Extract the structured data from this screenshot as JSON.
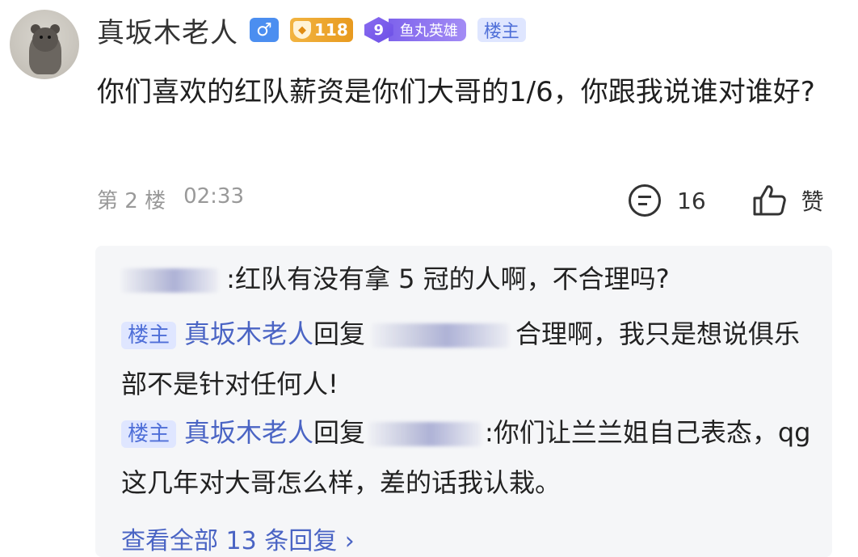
{
  "post": {
    "username": "真坂木老人",
    "gender_icon": "♂",
    "level": "118",
    "fan_level": "9",
    "fan_badge_name": "鱼丸英雄",
    "op_label": "楼主",
    "content": "你们喜欢的红队薪资是你们大哥的1/6，你跟我说谁对谁好?",
    "floor": "第 2 楼",
    "time": "02:33",
    "comment_count": "16",
    "like_label": "赞"
  },
  "replies": [
    {
      "text": ":红队有没有拿 5 冠的人啊，不合理吗?"
    },
    {
      "op_tag": "楼主",
      "user": "真坂木老人",
      "verb": "回复",
      "text": "合理啊，我只是想说俱乐部不是针对任何人!"
    },
    {
      "op_tag": "楼主",
      "user": "真坂木老人",
      "verb": "回复",
      "text": ":你们让兰兰姐自己表态，qg这几年对大哥怎么样，差的话我认栽。"
    }
  ],
  "view_all": "查看全部 13 条回复 ›",
  "colors": {
    "link": "#4a64c4",
    "op_badge_bg": "#dfe6ff",
    "reply_bg": "#f5f6f8"
  }
}
